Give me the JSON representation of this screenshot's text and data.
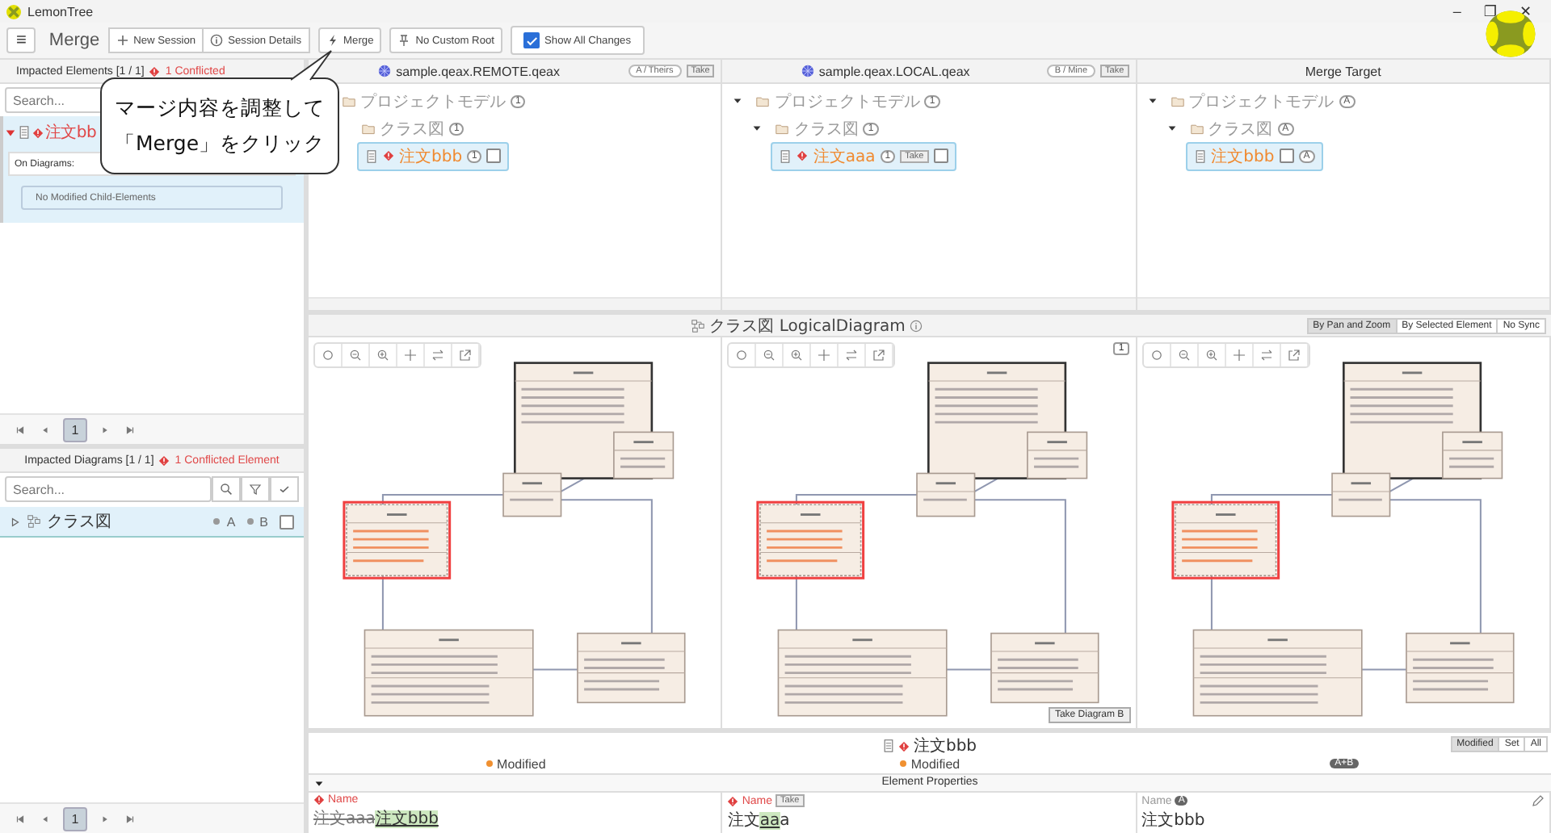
{
  "window": {
    "title": "LemonTree",
    "controls": [
      "–",
      "❐",
      "✕"
    ]
  },
  "toolbar": {
    "menu": "≡",
    "title": "Merge",
    "buttons": [
      {
        "label": "New Session",
        "kind": "plus"
      },
      {
        "label": "Session Details",
        "kind": "info"
      }
    ],
    "merge": "Merge",
    "custom_root": "No Custom Root",
    "show_all": {
      "label": "Show All Changes",
      "checked": true
    }
  },
  "callout": {
    "lines": [
      "マージ内容を調整して",
      "「Merge」をクリック"
    ]
  },
  "impacted_elements": {
    "title": "Impacted Elements [1 / 1]",
    "conflicts": "1 Conflicted",
    "search": {
      "placeholder": "Search..."
    },
    "items": [
      {
        "label": "注文bb",
        "conflict": true,
        "selected": true,
        "expanded": true,
        "on_diagrams": "On Diagrams:",
        "note": "No Modified Child-Elements"
      }
    ],
    "pages": [
      {
        "label": "1",
        "selected": true
      }
    ]
  },
  "impacted_diagrams": {
    "title": "Impacted Diagrams [1 / 1]",
    "conflicts": "1 Conflicted Element",
    "search": {
      "placeholder": "Search..."
    },
    "items": [
      {
        "label": "クラス図",
        "selected": true,
        "expanded": false,
        "tags": [
          "A",
          "B"
        ],
        "checked": false
      }
    ],
    "pages": [
      {
        "label": "1",
        "selected": true
      }
    ]
  },
  "models": [
    {
      "title": "sample.qeax.REMOTE.qeax",
      "kind": "source",
      "side": "A / Theirs",
      "take": "Take",
      "tree": [
        {
          "label": "プロジェクトモデル",
          "kind": "folder",
          "badge": "1",
          "selected": false,
          "children": [
            {
              "label": "クラス図",
              "kind": "folder",
              "badge": "1",
              "selected": false,
              "children": [
                {
                  "label": "注文bbb",
                  "kind": "class",
                  "badge": "1",
                  "conflict": true,
                  "selected": true,
                  "checked": false
                }
              ]
            }
          ]
        }
      ]
    },
    {
      "title": "sample.qeax.LOCAL.qeax",
      "kind": "source",
      "side": "B / Mine",
      "take": "Take",
      "tree": [
        {
          "label": "プロジェクトモデル",
          "kind": "folder",
          "badge": "1",
          "expanded": true,
          "selected": false,
          "children": [
            {
              "label": "クラス図",
              "kind": "folder",
              "badge": "1",
              "expanded": true,
              "selected": false,
              "children": [
                {
                  "label": "注文aaa",
                  "kind": "class",
                  "badge": "1",
                  "conflict": true,
                  "take": "Take",
                  "selected": true,
                  "checked": false
                }
              ]
            }
          ]
        }
      ]
    },
    {
      "title": "Merge Target",
      "kind": "target",
      "tree": [
        {
          "label": "プロジェクトモデル",
          "kind": "folder",
          "badge": "A",
          "expanded": true,
          "selected": false,
          "children": [
            {
              "label": "クラス図",
              "kind": "folder",
              "badge": "A",
              "expanded": true,
              "selected": false,
              "children": [
                {
                  "label": "注文bbb",
                  "kind": "class",
                  "badge": "A",
                  "conflict": false,
                  "selected": true,
                  "checked": false
                }
              ]
            }
          ]
        }
      ]
    }
  ],
  "diagram": {
    "title": "クラス図 LogicalDiagram",
    "sync": [
      {
        "label": "By Pan and Zoom",
        "selected": true
      },
      {
        "label": "By Selected Element",
        "selected": false
      },
      {
        "label": "No Sync",
        "selected": false
      }
    ],
    "panes": [
      {
        "kind": "diagram"
      },
      {
        "kind": "diagram",
        "badge": "1",
        "take": "Take Diagram B"
      },
      {
        "kind": "diagram"
      }
    ]
  },
  "details": {
    "element": {
      "label": "注文bbb",
      "conflict": true
    },
    "columns": [
      {
        "status": "Modified"
      },
      {
        "status": "Modified"
      },
      {
        "badge": "A+B"
      }
    ],
    "filter": [
      {
        "label": "Modified",
        "selected": true
      },
      {
        "label": "Set",
        "selected": false
      },
      {
        "label": "All",
        "selected": false
      }
    ],
    "section": "Element Properties",
    "properties": [
      {
        "name": "Name",
        "conflict": true,
        "value": [
          {
            "text": "注文aaa",
            "kind": "del"
          },
          {
            "text": "注文bbb",
            "kind": "ins"
          }
        ]
      },
      {
        "name": "Name",
        "conflict": true,
        "take": "Take",
        "value": [
          {
            "text": "注文",
            "kind": "same"
          },
          {
            "text": "aa",
            "kind": "ins"
          },
          {
            "text": "a",
            "kind": "same"
          }
        ]
      },
      {
        "name": "Name",
        "conflict": false,
        "badge": "A",
        "editable": true,
        "value": [
          {
            "text": "注文bbb",
            "kind": "same"
          }
        ]
      }
    ]
  }
}
